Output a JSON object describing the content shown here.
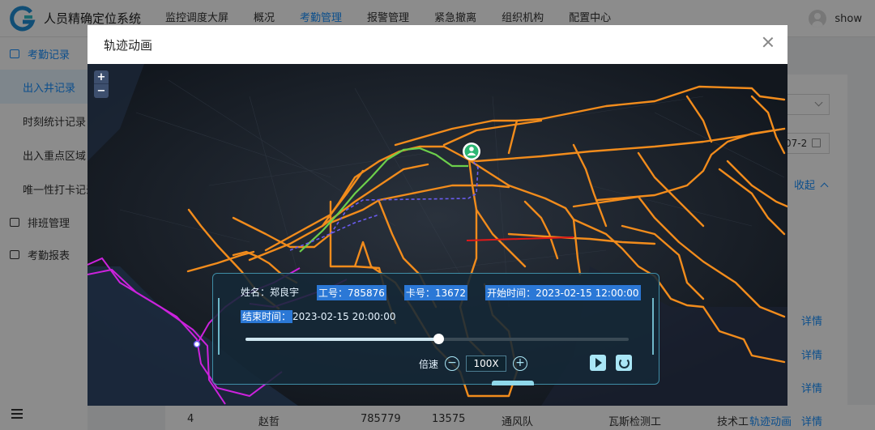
{
  "app": {
    "title": "人员精确定位系统",
    "username": "show"
  },
  "nav": {
    "items": [
      {
        "label": "监控调度大屏",
        "active": false
      },
      {
        "label": "概况",
        "active": false
      },
      {
        "label": "考勤管理",
        "active": true
      },
      {
        "label": "报警管理",
        "active": false
      },
      {
        "label": "紧急撤离",
        "active": false
      },
      {
        "label": "组织机构",
        "active": false
      },
      {
        "label": "配置中心",
        "active": false
      }
    ]
  },
  "sidebar": {
    "group_attendance": "考勤记录",
    "subitems": [
      {
        "label": "出入井记录",
        "active": true
      },
      {
        "label": "时刻统计记录",
        "active": false
      },
      {
        "label": "出入重点区域",
        "active": false
      },
      {
        "label": "唯一性打卡记录",
        "active": false
      }
    ],
    "group_schedule": "排班管理",
    "group_report": "考勤报表"
  },
  "background": {
    "date_partial": "07-2",
    "collapse_label": "收起",
    "detail_label": "详情",
    "row": {
      "index": "4",
      "name": "赵哲",
      "job_no": "785779",
      "card_no": "13575",
      "team": "通风队",
      "position": "瓦斯检测工",
      "type": "技术工",
      "track_link": "轨迹动画",
      "detail_link": "详情"
    }
  },
  "modal": {
    "title": "轨迹动画",
    "zoom_in": "+",
    "zoom_out": "−",
    "panel": {
      "name_label": "姓名：",
      "name_value": "郑良宇",
      "job_label": "工号：",
      "job_value": "785876",
      "card_label": "卡号：",
      "card_value": "13672",
      "start_label": "开始时间：",
      "start_value": "2023-02-15 12:00:00",
      "end_label": "结束时间：",
      "end_value": "2023-02-15 20:00:00",
      "progress": 0.503,
      "speed_label": "倍速",
      "speed_value": "100X",
      "minus": "−",
      "plus": "+"
    }
  },
  "colors": {
    "accent": "#1890ff",
    "track_orange": "#f28c1c",
    "track_green": "#6ccf4b",
    "track_purple": "#cc22dd",
    "track_red": "#e01818",
    "panel_border": "#3f8da6"
  }
}
